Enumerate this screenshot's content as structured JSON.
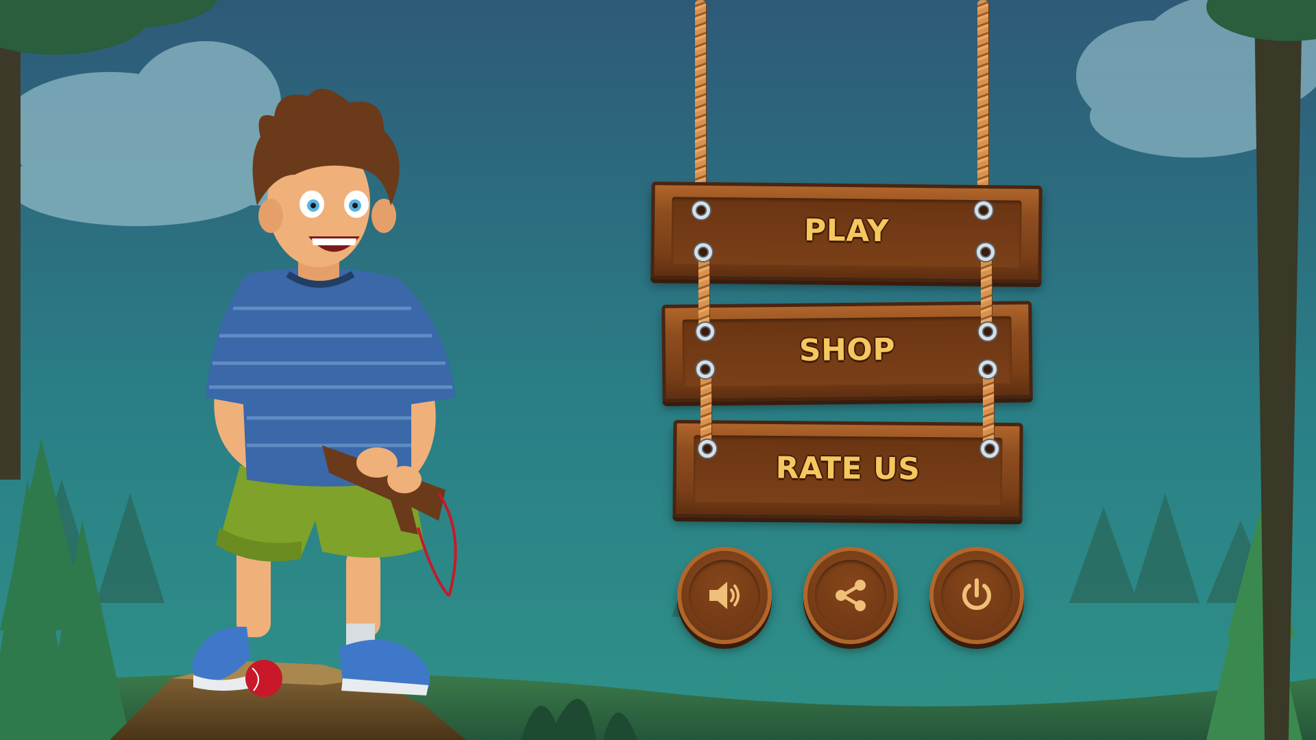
{
  "menu": {
    "buttons": [
      {
        "label": "PLAY"
      },
      {
        "label": "SHOP"
      },
      {
        "label": "RATE US"
      }
    ],
    "icon_buttons": [
      {
        "icon": "speaker-icon"
      },
      {
        "icon": "share-icon"
      },
      {
        "icon": "power-icon"
      }
    ]
  },
  "colors": {
    "sky_top": "#2f5f7c",
    "sky_bottom": "#2c8f8e",
    "label_text": "#f6c65f",
    "wood": "#7a3f18"
  }
}
